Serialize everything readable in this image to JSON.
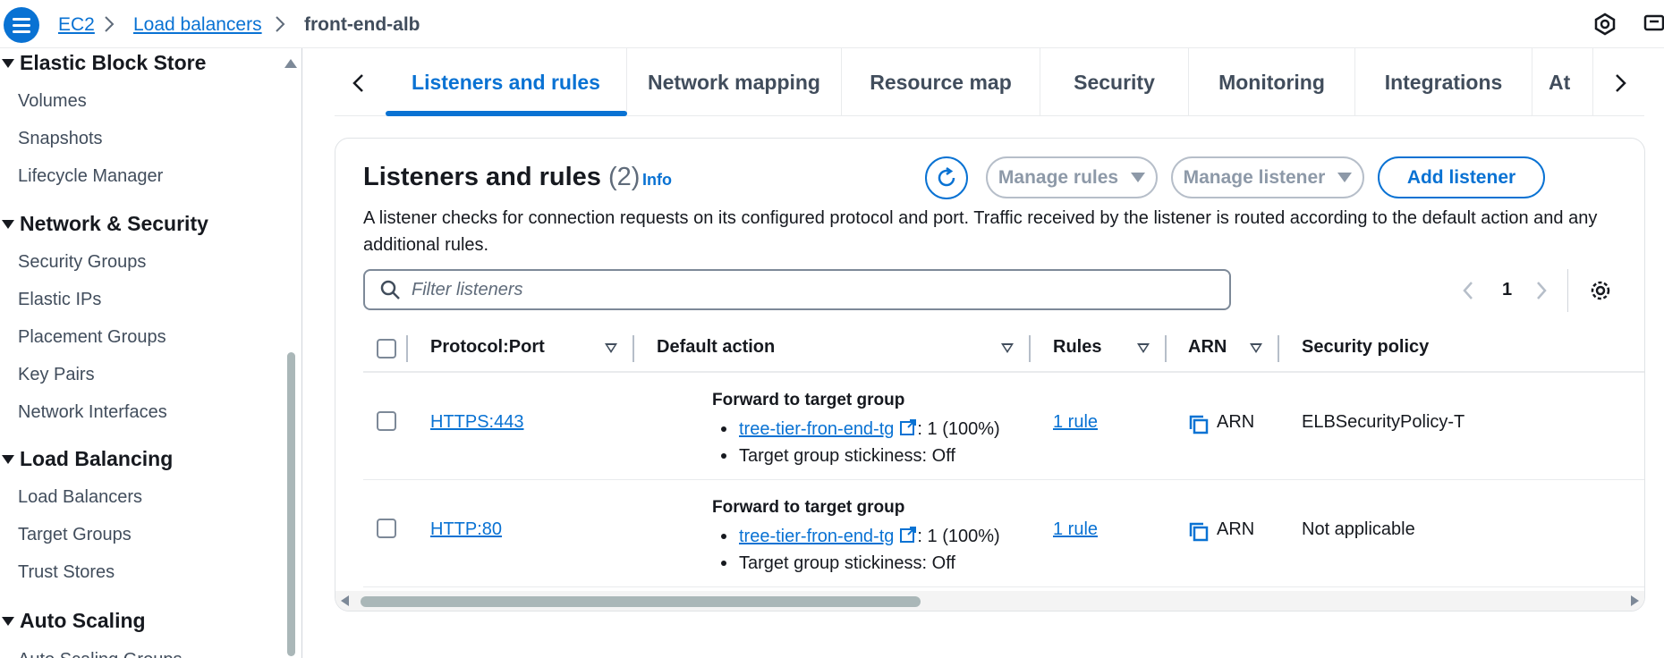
{
  "breadcrumb": {
    "items": [
      "EC2",
      "Load balancers"
    ],
    "current": "front-end-alb"
  },
  "sidebar": {
    "sections": [
      {
        "label": "Elastic Block Store",
        "items": [
          "Volumes",
          "Snapshots",
          "Lifecycle Manager"
        ]
      },
      {
        "label": "Network & Security",
        "items": [
          "Security Groups",
          "Elastic IPs",
          "Placement Groups",
          "Key Pairs",
          "Network Interfaces"
        ]
      },
      {
        "label": "Load Balancing",
        "items": [
          "Load Balancers",
          "Target Groups",
          "Trust Stores"
        ]
      },
      {
        "label": "Auto Scaling",
        "items": [
          "Auto Scaling Groups"
        ]
      }
    ]
  },
  "tabs": {
    "items": [
      "Listeners and rules",
      "Network mapping",
      "Resource map",
      "Security",
      "Monitoring",
      "Integrations",
      "At"
    ],
    "active": "Listeners and rules"
  },
  "listeners": {
    "title": "Listeners and rules",
    "count": "(2)",
    "info": "Info",
    "manage_rules": "Manage rules",
    "manage_listener": "Manage listener",
    "add_listener": "Add listener",
    "description": "A listener checks for connection requests on its configured protocol and port. Traffic received by the listener is routed according to the default action and any additional rules.",
    "filter_placeholder": "Filter listeners",
    "page": "1",
    "columns": [
      "Protocol:Port",
      "Default action",
      "Rules",
      "ARN",
      "Security policy"
    ],
    "rows": [
      {
        "protocol_port": "HTTPS:443",
        "action_title": "Forward to target group",
        "target_group": "tree-tier-fron-end-tg",
        "weight": ": 1 (100%)",
        "stickiness": "Target group stickiness: Off",
        "rules": "1 rule",
        "arn": "ARN",
        "security_policy": "ELBSecurityPolicy-T"
      },
      {
        "protocol_port": "HTTP:80",
        "action_title": "Forward to target group",
        "target_group": "tree-tier-fron-end-tg",
        "weight": ": 1 (100%)",
        "stickiness": "Target group stickiness: Off",
        "rules": "1 rule",
        "arn": "ARN",
        "security_policy": "Not applicable"
      }
    ]
  },
  "colors": {
    "accent": "#0972d3",
    "text": "#16191f",
    "muted": "#414d5c",
    "disabled": "#8d99a8"
  }
}
